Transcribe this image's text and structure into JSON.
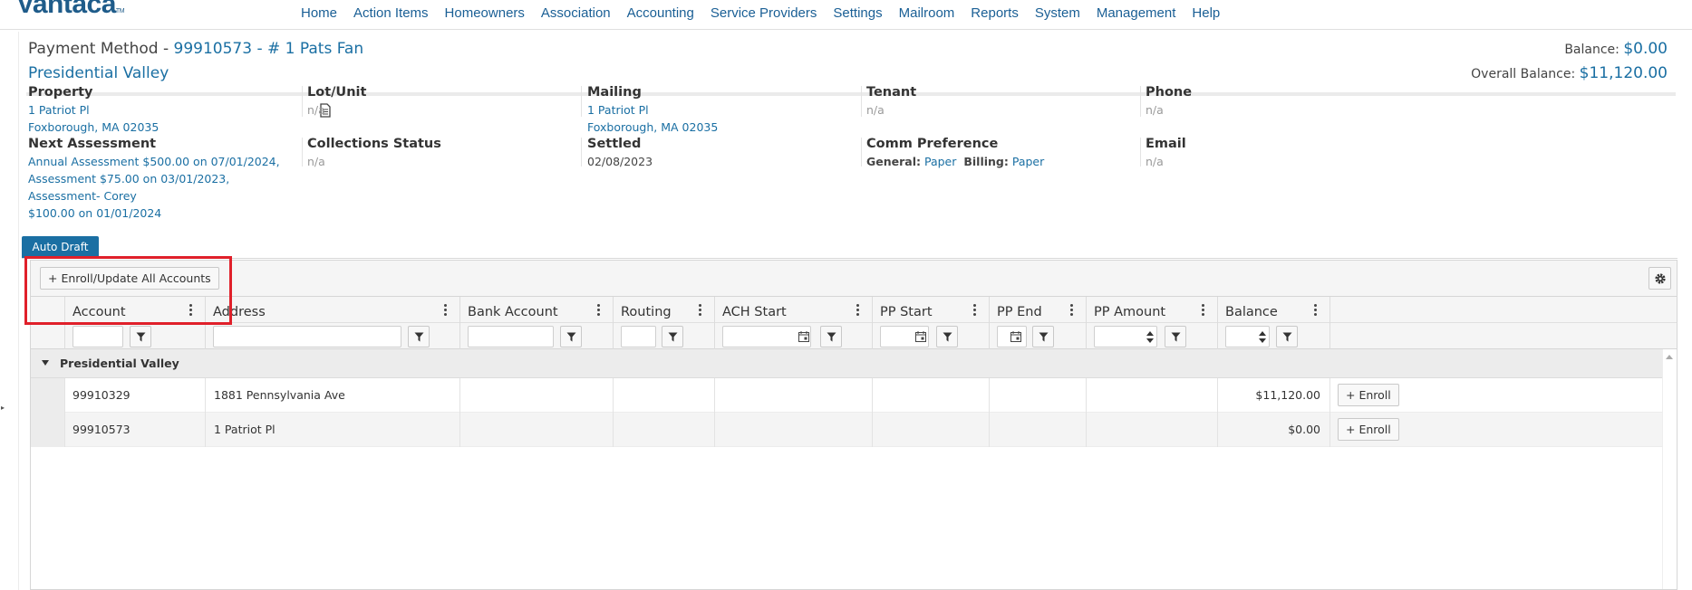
{
  "app": {
    "logo": "Vantaca",
    "logo_mark": "TM"
  },
  "nav": [
    "Home",
    "Action Items",
    "Homeowners",
    "Association",
    "Accounting",
    "Service Providers",
    "Settings",
    "Mailroom",
    "Reports",
    "System",
    "Management",
    "Help"
  ],
  "header": {
    "title_prefix": "Payment Method - ",
    "account_link": "99910573 - # 1 Pats Fan",
    "association": "Presidential Valley",
    "balance_label": "Balance:",
    "balance_value": "$0.00",
    "overall_label": "Overall Balance:",
    "overall_value": "$11,120.00"
  },
  "info": {
    "property": {
      "label": "Property",
      "line1": "1 Patriot Pl",
      "line2": "Foxborough, MA 02035"
    },
    "lot": {
      "label": "Lot/Unit",
      "value": "n/a"
    },
    "mailing": {
      "label": "Mailing",
      "line1": "1 Patriot Pl",
      "line2": "Foxborough, MA 02035"
    },
    "tenant": {
      "label": "Tenant",
      "value": "n/a"
    },
    "phone": {
      "label": "Phone",
      "value": "n/a"
    },
    "next_assessment": {
      "label": "Next Assessment",
      "line1": "Annual Assessment $500.00 on 07/01/2024,",
      "line2": "Assessment $75.00 on 03/01/2023, Assessment- Corey",
      "line3": "$100.00 on 01/01/2024"
    },
    "collections": {
      "label": "Collections Status",
      "value": "n/a"
    },
    "settled": {
      "label": "Settled",
      "value": "02/08/2023"
    },
    "comm": {
      "label": "Comm Preference",
      "general_label": "General:",
      "general_value": "Paper",
      "billing_label": "Billing:",
      "billing_value": "Paper"
    },
    "email": {
      "label": "Email",
      "value": "n/a"
    }
  },
  "tab": {
    "label": "Auto Draft"
  },
  "toolbar": {
    "enroll_all_label": "Enroll/Update All Accounts",
    "plus": "+"
  },
  "grid": {
    "columns": [
      "Account",
      "Address",
      "Bank Account",
      "Routing",
      "ACH Start",
      "PP Start",
      "PP End",
      "PP Amount",
      "Balance"
    ],
    "group": "Presidential Valley",
    "rows": [
      {
        "account": "99910329",
        "address": "1881 Pennsylvania Ave",
        "bank": "",
        "routing": "",
        "ach": "",
        "pp_start": "",
        "pp_end": "",
        "pp_amount": "",
        "balance": "$11,120.00",
        "action": "Enroll"
      },
      {
        "account": "99910573",
        "address": "1 Patriot Pl",
        "bank": "",
        "routing": "",
        "ach": "",
        "pp_start": "",
        "pp_end": "",
        "pp_amount": "",
        "balance": "$0.00",
        "action": "Enroll"
      }
    ]
  },
  "colors": {
    "brand": "#1f5c8a",
    "link": "#1a6fa3",
    "highlight": "#e0202a"
  }
}
